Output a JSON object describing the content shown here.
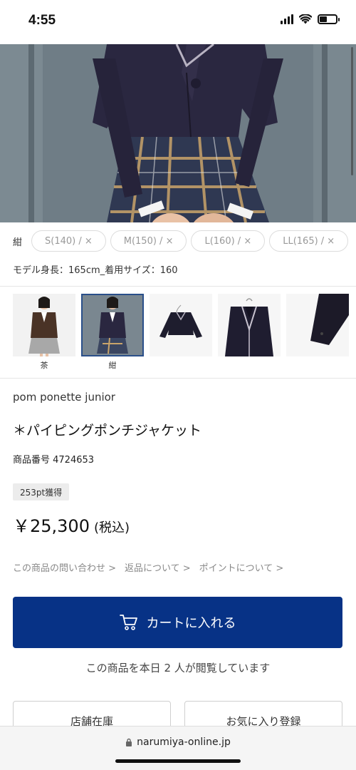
{
  "status_bar": {
    "time": "4:55"
  },
  "product": {
    "color_label": "紺",
    "sizes": [
      "S(140) / ×",
      "M(150) / ×",
      "L(160) / ×",
      "LL(165) / ×"
    ],
    "model_info": "モデル身長：165cm_着用サイズ：160",
    "thumbnails": [
      {
        "label": "茶",
        "kind": "model-brown"
      },
      {
        "label": "紺",
        "kind": "model-navy",
        "selected": true
      },
      {
        "label": "",
        "kind": "jacket-front"
      },
      {
        "label": "",
        "kind": "jacket-detail"
      },
      {
        "label": "",
        "kind": "sleeve-detail"
      }
    ],
    "brand": "pom ponette junior",
    "name": "＊パイピングポンチジャケット",
    "number": "商品番号 4724653",
    "points": "253pt獲得",
    "price": "￥25,300",
    "tax": "(税込)"
  },
  "links": {
    "inquiry": "この商品の問い合わせ >",
    "returns": "返品について >",
    "points": "ポイントについて >"
  },
  "actions": {
    "cart_label": "カートに入れる",
    "viewer_text": "この商品を本日 2 人が閲覧しています",
    "store_stock": "店舗在庫",
    "favorite": "お気に入り登録"
  },
  "browser": {
    "url": "narumiya-online.jp"
  },
  "colors": {
    "accent": "#073286",
    "navy_jacket": "#2a2740"
  }
}
